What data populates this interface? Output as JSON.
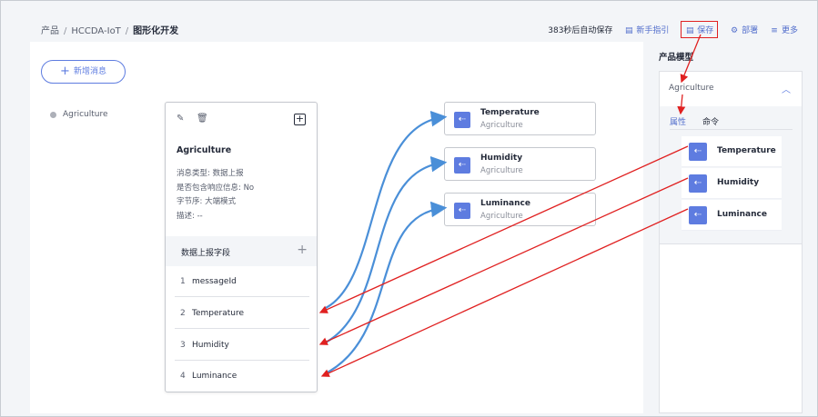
{
  "breadcrumb": {
    "item1": "产品",
    "item2": "HCCDA-IoT",
    "current": "图形化开发",
    "sep": "/"
  },
  "toolbar": {
    "autosave": "383秒后自动保存",
    "guide": "新手指引",
    "save": "保存",
    "deploy": "部署",
    "more": "更多"
  },
  "canvas": {
    "add_message": "新增消息",
    "message_list": [
      "Agriculture"
    ]
  },
  "message_card": {
    "title": "Agriculture",
    "info": [
      "消息类型: 数据上报",
      "是否包含响应信息: No",
      "字节序: 大端模式",
      "描述: --"
    ],
    "fields_header": "数据上报字段",
    "fields": [
      {
        "index": "1",
        "name": "messageId"
      },
      {
        "index": "2",
        "name": "Temperature"
      },
      {
        "index": "3",
        "name": "Humidity"
      },
      {
        "index": "4",
        "name": "Luminance"
      }
    ]
  },
  "mapped_properties": [
    {
      "name": "Temperature",
      "service": "Agriculture"
    },
    {
      "name": "Humidity",
      "service": "Agriculture"
    },
    {
      "name": "Luminance",
      "service": "Agriculture"
    }
  ],
  "product_model": {
    "title": "产品模型",
    "service": "Agriculture",
    "tabs": [
      "属性",
      "命令"
    ],
    "properties": [
      "Temperature",
      "Humidity",
      "Luminance"
    ]
  },
  "colors": {
    "accent": "#5e7ce0",
    "annotation": "#e02020",
    "link_line": "#4a8fd8"
  },
  "icons": [
    "edit-icon",
    "delete-icon",
    "add-field-icon",
    "property-icon",
    "chevron-up-icon",
    "document-icon",
    "gear-icon",
    "list-icon"
  ]
}
